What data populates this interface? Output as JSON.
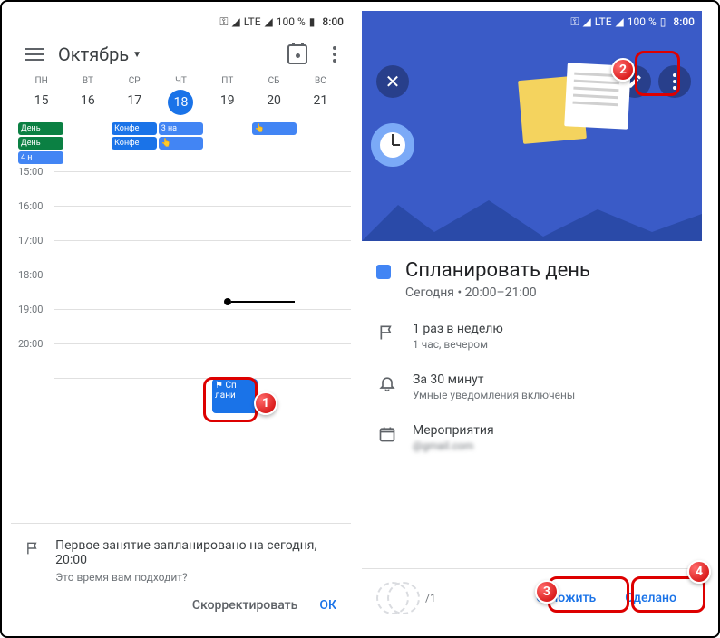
{
  "status": {
    "battery": "100 %",
    "time": "8:00",
    "network": "LTE"
  },
  "left": {
    "month": "Октябрь",
    "days": [
      "ПН",
      "ВТ",
      "СР",
      "ЧТ",
      "ПТ",
      "СБ",
      "ВС"
    ],
    "dates": [
      "15",
      "16",
      "17",
      "18",
      "19",
      "20",
      "21"
    ],
    "today_index": 3,
    "hours": [
      "15:00",
      "16:00",
      "17:00",
      "18:00",
      "19:00",
      "20:00",
      ""
    ],
    "events": {
      "row1": [
        "День",
        "",
        "Конфе",
        "3 на",
        "",
        "",
        ""
      ],
      "row2": [
        "День",
        "",
        "Конфе",
        "",
        "",
        "",
        ""
      ],
      "row3": [
        "4 н",
        "",
        "",
        "",
        "",
        "",
        ""
      ]
    },
    "splan_label": "Сп\nлани",
    "sheet": {
      "title": "Первое занятие запланировано на сегодня, 20:00",
      "sub": "Это время вам подходит?",
      "adjust": "Скорректировать",
      "ok": "ОК"
    }
  },
  "right": {
    "title": "Спланировать день",
    "time": "Сегодня • 20:00–21:00",
    "repeat": {
      "main": "1 раз в неделю",
      "sub": "1 час, вечером"
    },
    "notify": {
      "main": "За 30 минут",
      "sub": "Умные уведомления включены"
    },
    "account": {
      "main": "Мероприятия",
      "sub": "@gmail.com"
    },
    "progress": "/1",
    "postpone": "Отложить",
    "done": "Сделано"
  },
  "callouts": {
    "c1": "1",
    "c2": "2",
    "c3": "3",
    "c4": "4"
  }
}
